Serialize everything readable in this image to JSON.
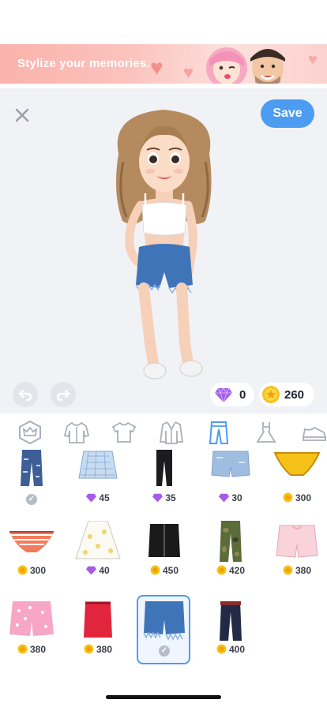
{
  "banner": {
    "text": "Stylize your memories."
  },
  "editor": {
    "save_label": "Save"
  },
  "currency": {
    "gems": "0",
    "coins": "260"
  },
  "tabs": [
    {
      "name": "crown",
      "active": false
    },
    {
      "name": "jacket",
      "active": false
    },
    {
      "name": "tshirt",
      "active": false
    },
    {
      "name": "coat",
      "active": false
    },
    {
      "name": "pants",
      "active": true
    },
    {
      "name": "dress",
      "active": false
    },
    {
      "name": "shoe",
      "active": false
    }
  ],
  "items": [
    {
      "type": "ripped-jeans",
      "price": "",
      "currency": "owned"
    },
    {
      "type": "plaid-skirt",
      "price": "45",
      "currency": "gem"
    },
    {
      "type": "black-leggings",
      "price": "35",
      "currency": "gem"
    },
    {
      "type": "denim-shorts-light",
      "price": "30",
      "currency": "gem"
    },
    {
      "type": "yellow-underwear",
      "price": "300",
      "currency": "coin"
    },
    {
      "type": "striped-underwear",
      "price": "300",
      "currency": "coin"
    },
    {
      "type": "floral-skirt",
      "price": "40",
      "currency": "gem"
    },
    {
      "type": "black-leather-skirt",
      "price": "450",
      "currency": "coin"
    },
    {
      "type": "camo-pants",
      "price": "420",
      "currency": "coin"
    },
    {
      "type": "pink-shorts",
      "price": "380",
      "currency": "coin"
    },
    {
      "type": "pink-pattern-shorts",
      "price": "380",
      "currency": "coin"
    },
    {
      "type": "red-skirt",
      "price": "380",
      "currency": "coin"
    },
    {
      "type": "frayed-denim-shorts",
      "price": "",
      "currency": "owned"
    },
    {
      "type": "dark-jeans-belt",
      "price": "400",
      "currency": "coin"
    }
  ],
  "colors": {
    "accent": "#4c9cf2",
    "coin": "#f7c21a",
    "gem": "#a45ce8"
  }
}
